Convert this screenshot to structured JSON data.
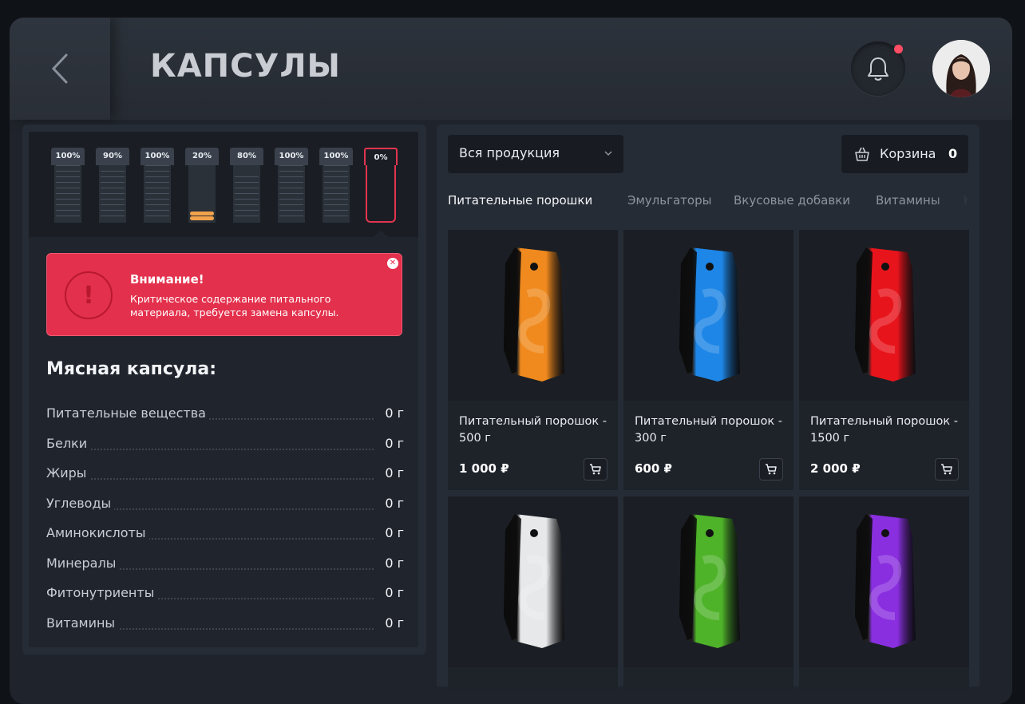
{
  "header": {
    "title": "КАПСУЛЫ",
    "has_notification": true,
    "notification_color": "#ff4d64"
  },
  "capsules": [
    {
      "label": "100%",
      "level": 1.0
    },
    {
      "label": "90%",
      "level": 0.9
    },
    {
      "label": "100%",
      "level": 1.0
    },
    {
      "label": "20%",
      "level": 0.2
    },
    {
      "label": "80%",
      "level": 0.8
    },
    {
      "label": "100%",
      "level": 1.0
    },
    {
      "label": "100%",
      "level": 1.0
    },
    {
      "label": "0%",
      "level": 0.0,
      "selected": true,
      "alert": true
    }
  ],
  "alert": {
    "title": "Внимание!",
    "text": "Критическое содержание питального материала, требуется замена капсулы.",
    "color": "#e3304c"
  },
  "capsule_details": {
    "title": "Мясная капсула:",
    "nutrients": [
      {
        "name": "Питательные вещества",
        "value": "0 г"
      },
      {
        "name": "Белки",
        "value": "0 г"
      },
      {
        "name": "Жиры",
        "value": "0 г"
      },
      {
        "name": "Углеводы",
        "value": "0 г"
      },
      {
        "name": "Аминокислоты",
        "value": "0 г"
      },
      {
        "name": "Минералы",
        "value": "0 г"
      },
      {
        "name": "Фитонутриенты",
        "value": "0 г"
      },
      {
        "name": "Витамины",
        "value": "0 г"
      }
    ]
  },
  "shop": {
    "filter": "Вся продукция",
    "cart_label": "Корзина",
    "cart_count": "0",
    "tabs": [
      "Питательные порошки",
      "Эмульгаторы",
      "Вкусовые добавки",
      "Витамины",
      "Кра"
    ],
    "active_tab": 0,
    "products": [
      {
        "title": "Питательный порошок - 500 г",
        "price": "1 000 ₽",
        "color": "#f08a1e"
      },
      {
        "title": "Питательный порошок - 300 г",
        "price": "600 ₽",
        "color": "#1e86e6"
      },
      {
        "title": "Питательный порошок - 1500 г",
        "price": "2 000 ₽",
        "color": "#e8141c"
      },
      {
        "title": "",
        "price": "",
        "color": "#e6e8ea"
      },
      {
        "title": "",
        "price": "",
        "color": "#4fb32a"
      },
      {
        "title": "",
        "price": "",
        "color": "#8a2fe0"
      }
    ]
  }
}
